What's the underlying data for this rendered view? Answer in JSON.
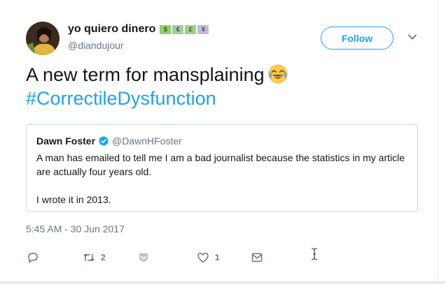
{
  "author": {
    "display_name": "yo quiero dinero",
    "handle": "@diandujour",
    "name_emoji": [
      "$",
      "€",
      "£",
      "¥"
    ],
    "follow_label": "Follow"
  },
  "tweet": {
    "text": "A new term for mansplaining",
    "emoji": "face-with-tears-of-joy",
    "hashtag": "#CorrectileDysfunction",
    "timestamp": "5:45 AM - 30 Jun 2017"
  },
  "quoted": {
    "name": "Dawn Foster",
    "handle": "@DawnHFoster",
    "verified": true,
    "lines": [
      "A man has emailed to tell me I am a bad journalist because the statistics in my article are actually four years old.",
      "I wrote it in 2013."
    ]
  },
  "actions": {
    "reply_icon": "reply-icon",
    "retweet_count": "2",
    "like_count": "1",
    "colors": {
      "accent": "#1da1f2",
      "muted": "#657786",
      "text": "#14171a",
      "border": "#ccd6dd"
    }
  }
}
